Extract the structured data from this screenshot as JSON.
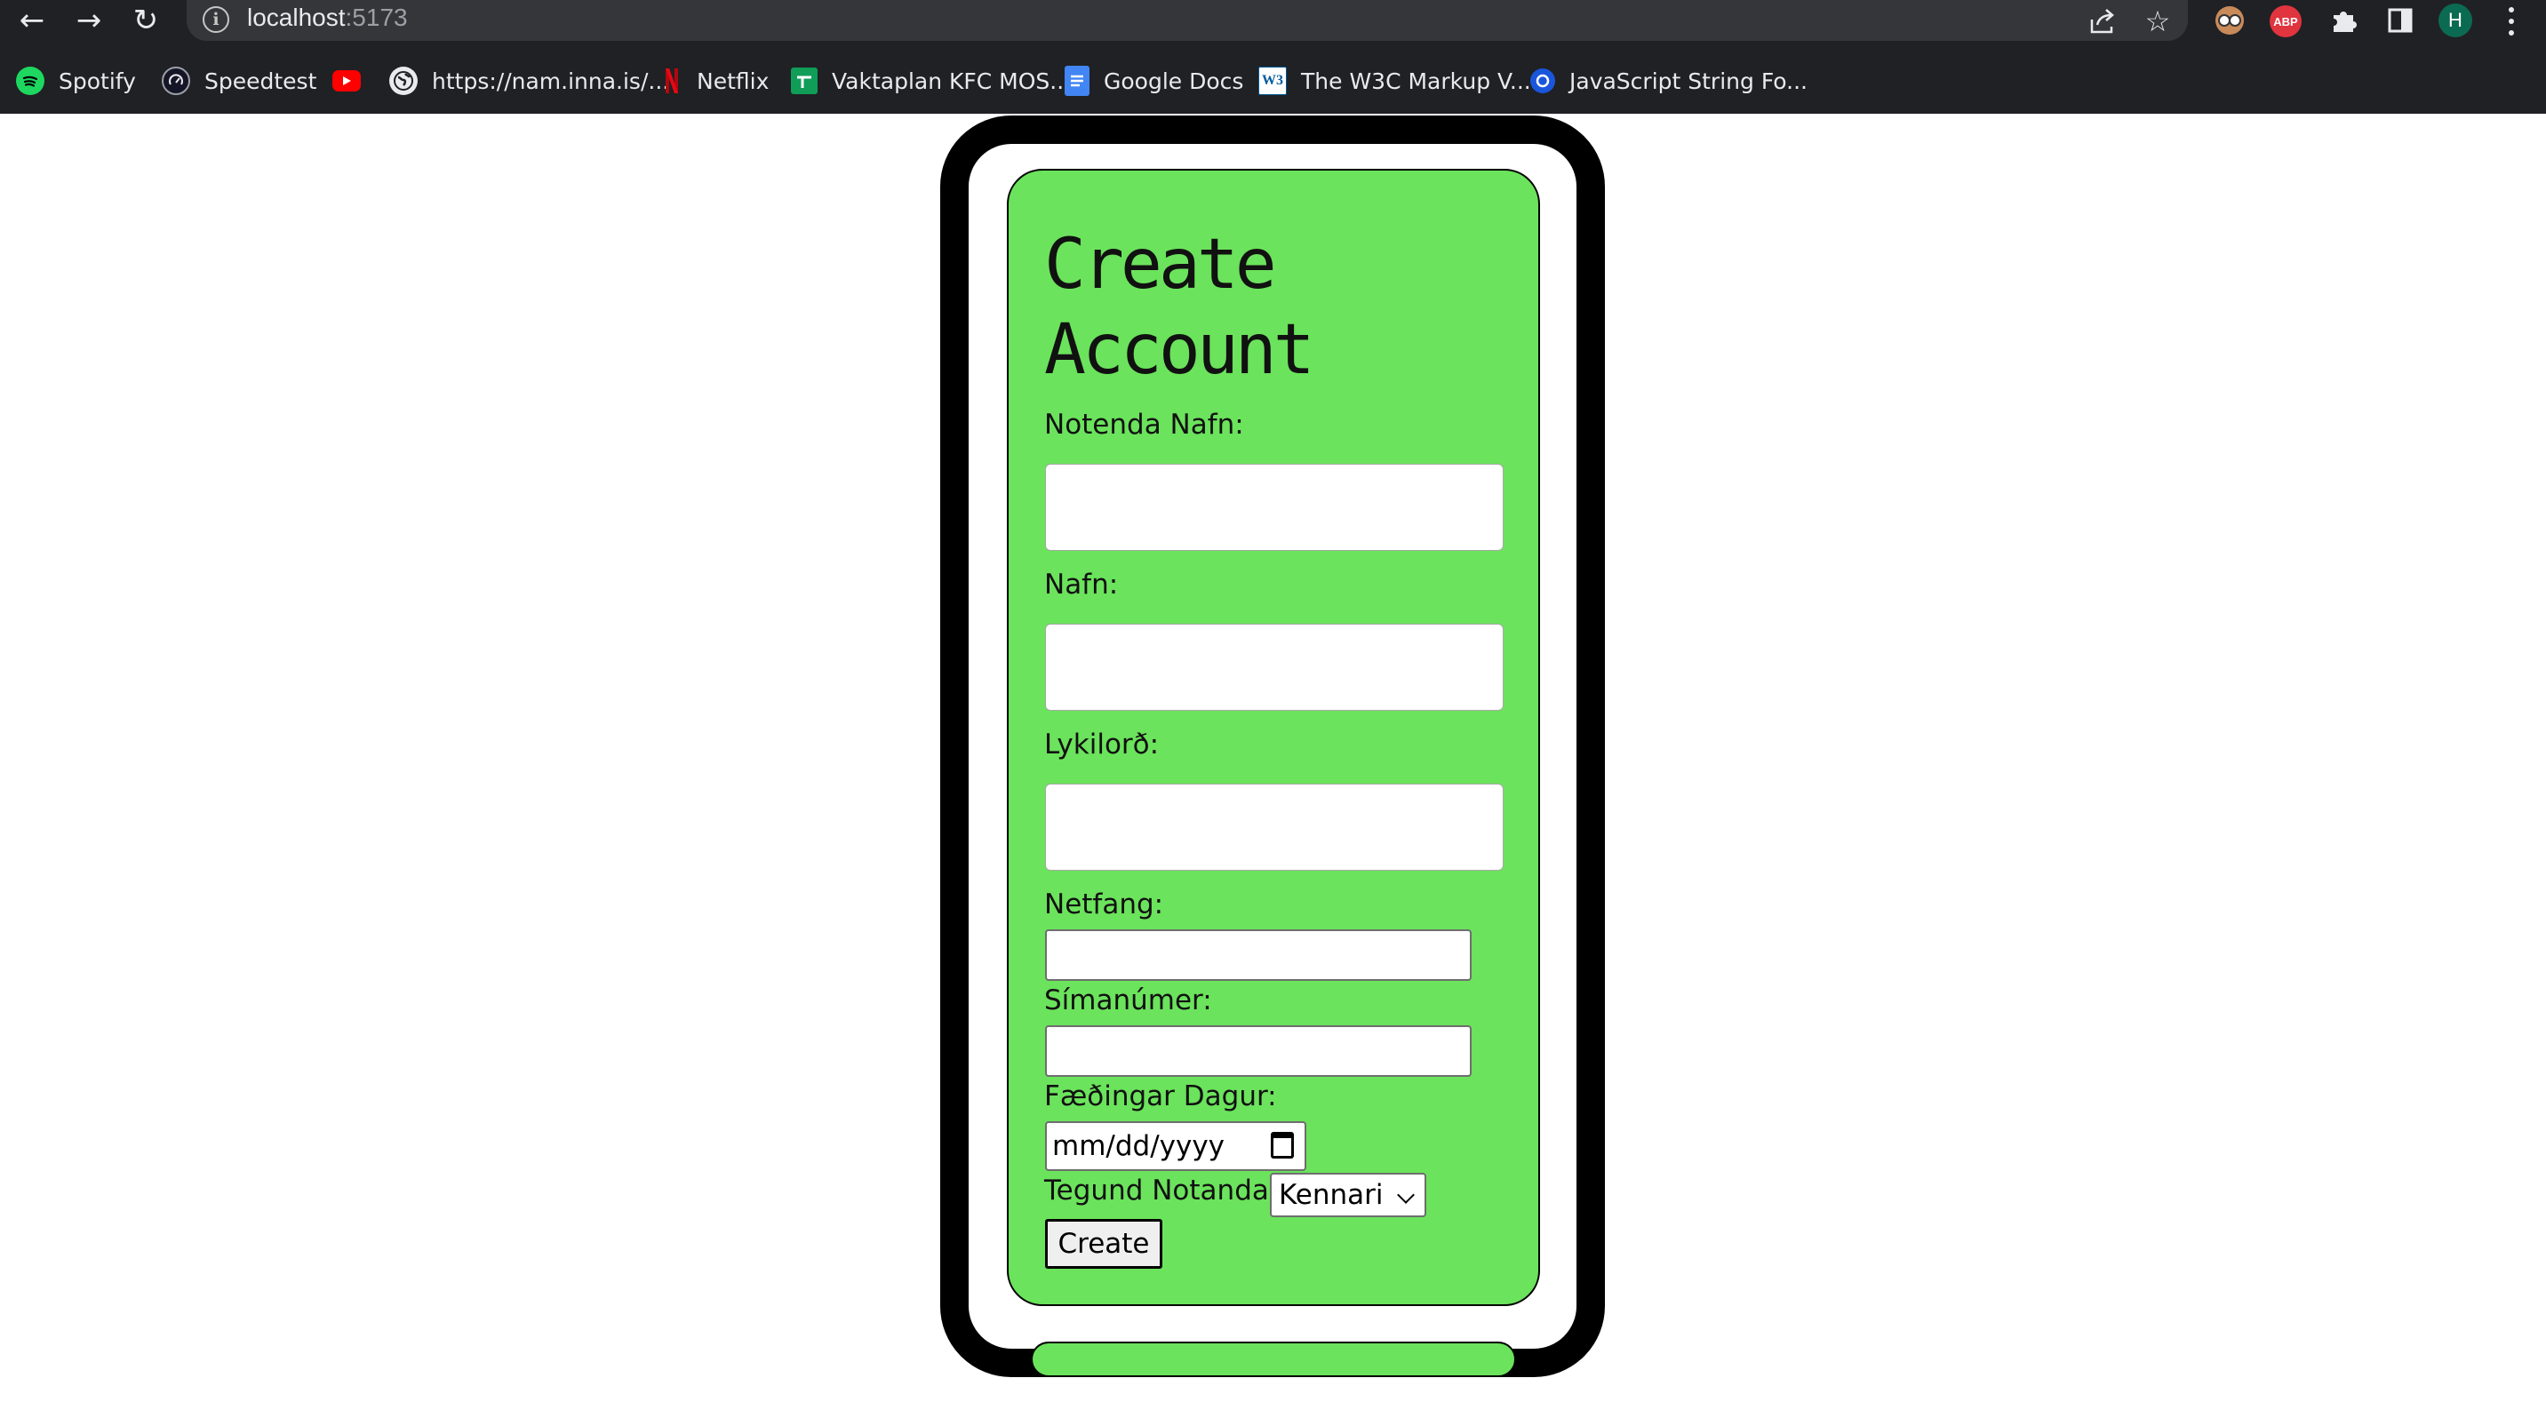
{
  "browser": {
    "url_host": "localhost",
    "url_port": ":5173",
    "profile_initial": "H",
    "extensions": [
      "reader-mode-icon",
      "adblock-plus-icon",
      "puzzle-extensions-icon",
      "side-panel-icon"
    ],
    "abp_label": "ABP"
  },
  "bookmarks": [
    {
      "label": "Spotify",
      "icon": "spotify-icon",
      "color": "#1ed760"
    },
    {
      "label": "Speedtest",
      "icon": "speedtest-icon",
      "color": "#141526"
    },
    {
      "label": "",
      "icon": "youtube-icon",
      "color": "#ff0000"
    },
    {
      "label": "https://nam.inna.is/...",
      "icon": "globe-icon",
      "color": "#e8eaed"
    },
    {
      "label": "Netflix",
      "icon": "netflix-icon",
      "color": "#e50914"
    },
    {
      "label": "Vaktaplan KFC MOS...",
      "icon": "sheets-icon",
      "color": "#0f9d58"
    },
    {
      "label": "Google Docs",
      "icon": "docs-icon",
      "color": "#4285f4"
    },
    {
      "label": "The W3C Markup V...",
      "icon": "w3c-icon",
      "color": "#005a9c"
    },
    {
      "label": "JavaScript String Fo...",
      "icon": "js-site-icon",
      "color": "#1a56db"
    }
  ],
  "form": {
    "title_line1": "Create",
    "title_line2": "Account",
    "username_label": "Notenda Nafn:",
    "name_label": "Nafn:",
    "password_label": "Lykilorð:",
    "email_label": "Netfang:",
    "phone_label": "Símanúmer:",
    "birthday_label": "Fæðingar Dagur:",
    "birthday_placeholder": "mm/dd/yyyy",
    "usertype_label": "Tegund Notanda:",
    "usertype_selected": "Kennari",
    "submit_label": "Create"
  },
  "colors": {
    "card_green": "#6be35c",
    "chrome_dark": "#202124"
  }
}
